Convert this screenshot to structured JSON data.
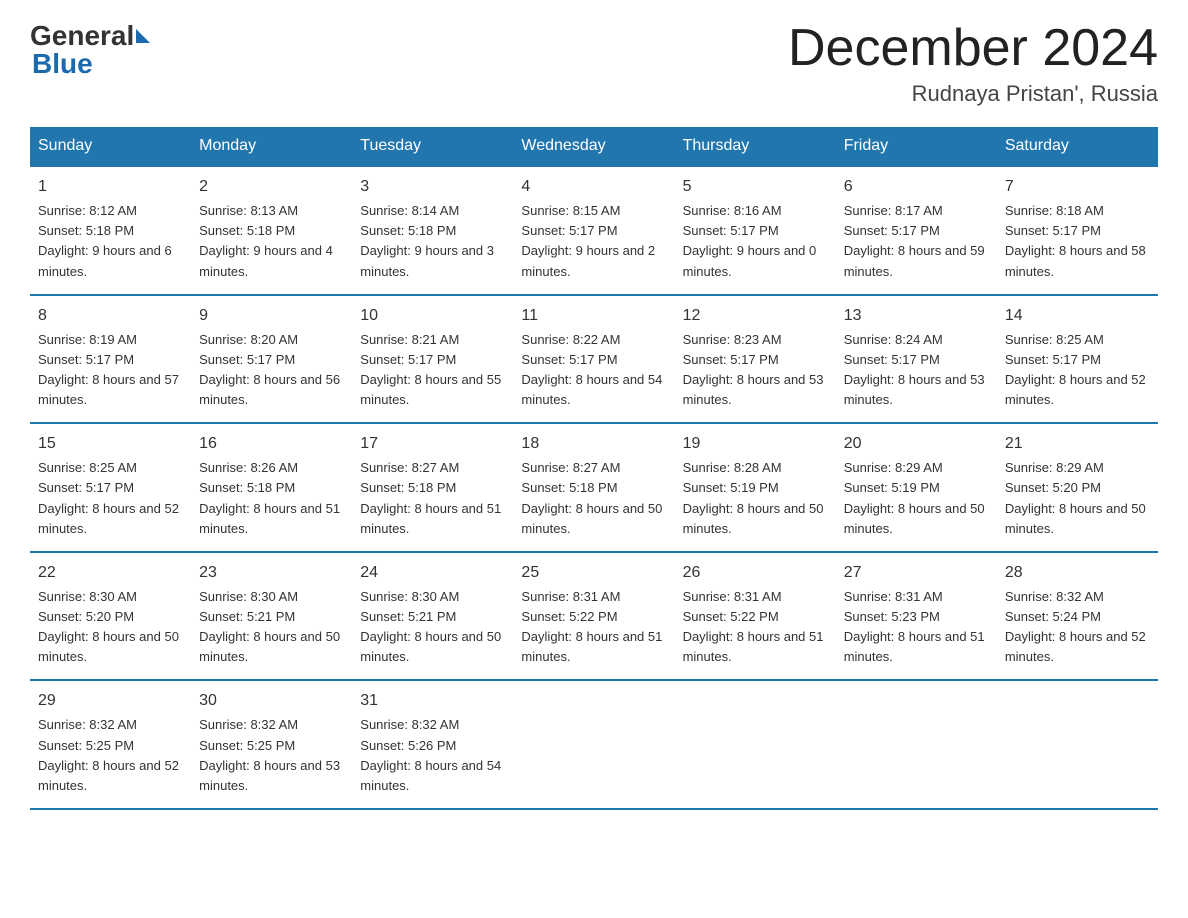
{
  "header": {
    "logo": {
      "general": "General",
      "blue": "Blue"
    },
    "title": "December 2024",
    "location": "Rudnaya Pristan', Russia"
  },
  "calendar": {
    "days_of_week": [
      "Sunday",
      "Monday",
      "Tuesday",
      "Wednesday",
      "Thursday",
      "Friday",
      "Saturday"
    ],
    "weeks": [
      [
        {
          "day": "1",
          "sunrise": "8:12 AM",
          "sunset": "5:18 PM",
          "daylight": "9 hours and 6 minutes."
        },
        {
          "day": "2",
          "sunrise": "8:13 AM",
          "sunset": "5:18 PM",
          "daylight": "9 hours and 4 minutes."
        },
        {
          "day": "3",
          "sunrise": "8:14 AM",
          "sunset": "5:18 PM",
          "daylight": "9 hours and 3 minutes."
        },
        {
          "day": "4",
          "sunrise": "8:15 AM",
          "sunset": "5:17 PM",
          "daylight": "9 hours and 2 minutes."
        },
        {
          "day": "5",
          "sunrise": "8:16 AM",
          "sunset": "5:17 PM",
          "daylight": "9 hours and 0 minutes."
        },
        {
          "day": "6",
          "sunrise": "8:17 AM",
          "sunset": "5:17 PM",
          "daylight": "8 hours and 59 minutes."
        },
        {
          "day": "7",
          "sunrise": "8:18 AM",
          "sunset": "5:17 PM",
          "daylight": "8 hours and 58 minutes."
        }
      ],
      [
        {
          "day": "8",
          "sunrise": "8:19 AM",
          "sunset": "5:17 PM",
          "daylight": "8 hours and 57 minutes."
        },
        {
          "day": "9",
          "sunrise": "8:20 AM",
          "sunset": "5:17 PM",
          "daylight": "8 hours and 56 minutes."
        },
        {
          "day": "10",
          "sunrise": "8:21 AM",
          "sunset": "5:17 PM",
          "daylight": "8 hours and 55 minutes."
        },
        {
          "day": "11",
          "sunrise": "8:22 AM",
          "sunset": "5:17 PM",
          "daylight": "8 hours and 54 minutes."
        },
        {
          "day": "12",
          "sunrise": "8:23 AM",
          "sunset": "5:17 PM",
          "daylight": "8 hours and 53 minutes."
        },
        {
          "day": "13",
          "sunrise": "8:24 AM",
          "sunset": "5:17 PM",
          "daylight": "8 hours and 53 minutes."
        },
        {
          "day": "14",
          "sunrise": "8:25 AM",
          "sunset": "5:17 PM",
          "daylight": "8 hours and 52 minutes."
        }
      ],
      [
        {
          "day": "15",
          "sunrise": "8:25 AM",
          "sunset": "5:17 PM",
          "daylight": "8 hours and 52 minutes."
        },
        {
          "day": "16",
          "sunrise": "8:26 AM",
          "sunset": "5:18 PM",
          "daylight": "8 hours and 51 minutes."
        },
        {
          "day": "17",
          "sunrise": "8:27 AM",
          "sunset": "5:18 PM",
          "daylight": "8 hours and 51 minutes."
        },
        {
          "day": "18",
          "sunrise": "8:27 AM",
          "sunset": "5:18 PM",
          "daylight": "8 hours and 50 minutes."
        },
        {
          "day": "19",
          "sunrise": "8:28 AM",
          "sunset": "5:19 PM",
          "daylight": "8 hours and 50 minutes."
        },
        {
          "day": "20",
          "sunrise": "8:29 AM",
          "sunset": "5:19 PM",
          "daylight": "8 hours and 50 minutes."
        },
        {
          "day": "21",
          "sunrise": "8:29 AM",
          "sunset": "5:20 PM",
          "daylight": "8 hours and 50 minutes."
        }
      ],
      [
        {
          "day": "22",
          "sunrise": "8:30 AM",
          "sunset": "5:20 PM",
          "daylight": "8 hours and 50 minutes."
        },
        {
          "day": "23",
          "sunrise": "8:30 AM",
          "sunset": "5:21 PM",
          "daylight": "8 hours and 50 minutes."
        },
        {
          "day": "24",
          "sunrise": "8:30 AM",
          "sunset": "5:21 PM",
          "daylight": "8 hours and 50 minutes."
        },
        {
          "day": "25",
          "sunrise": "8:31 AM",
          "sunset": "5:22 PM",
          "daylight": "8 hours and 51 minutes."
        },
        {
          "day": "26",
          "sunrise": "8:31 AM",
          "sunset": "5:22 PM",
          "daylight": "8 hours and 51 minutes."
        },
        {
          "day": "27",
          "sunrise": "8:31 AM",
          "sunset": "5:23 PM",
          "daylight": "8 hours and 51 minutes."
        },
        {
          "day": "28",
          "sunrise": "8:32 AM",
          "sunset": "5:24 PM",
          "daylight": "8 hours and 52 minutes."
        }
      ],
      [
        {
          "day": "29",
          "sunrise": "8:32 AM",
          "sunset": "5:25 PM",
          "daylight": "8 hours and 52 minutes."
        },
        {
          "day": "30",
          "sunrise": "8:32 AM",
          "sunset": "5:25 PM",
          "daylight": "8 hours and 53 minutes."
        },
        {
          "day": "31",
          "sunrise": "8:32 AM",
          "sunset": "5:26 PM",
          "daylight": "8 hours and 54 minutes."
        },
        null,
        null,
        null,
        null
      ]
    ]
  }
}
